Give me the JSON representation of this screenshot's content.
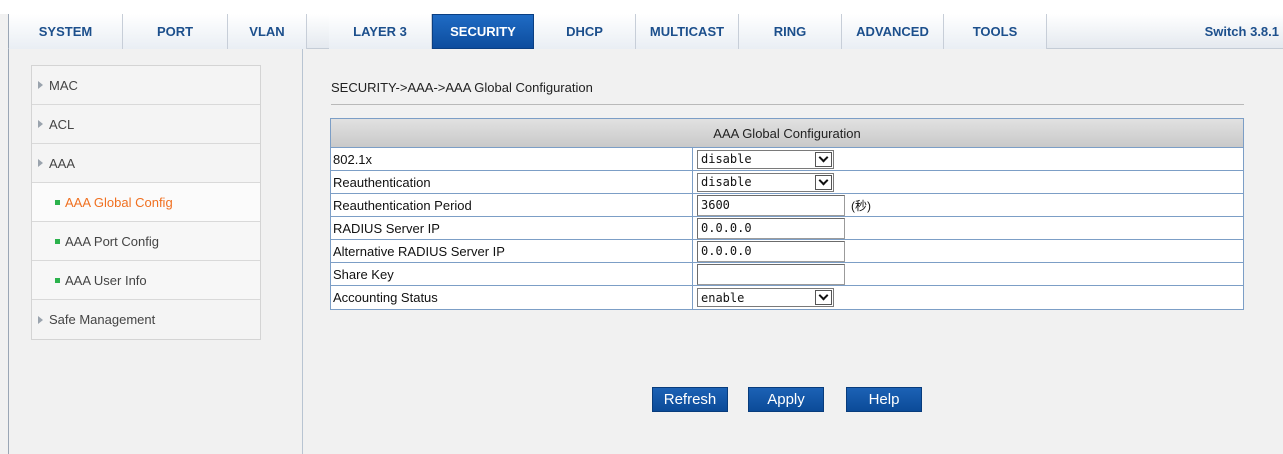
{
  "nav": {
    "tabs": [
      {
        "label": "SYSTEM"
      },
      {
        "label": "PORT"
      },
      {
        "label": "VLAN"
      },
      {
        "label": "LAYER 3"
      },
      {
        "label": "SECURITY"
      },
      {
        "label": "DHCP"
      },
      {
        "label": "MULTICAST"
      },
      {
        "label": "RING"
      },
      {
        "label": "ADVANCED"
      },
      {
        "label": "TOOLS"
      }
    ],
    "active_tab": "SECURITY",
    "version": "Switch 3.8.1"
  },
  "sidebar": {
    "items": [
      {
        "label": "MAC"
      },
      {
        "label": "ACL"
      },
      {
        "label": "AAA"
      },
      {
        "label": "AAA Global Config"
      },
      {
        "label": "AAA Port Config"
      },
      {
        "label": "AAA User Info"
      },
      {
        "label": "Safe Management"
      }
    ],
    "current": "AAA Global Config"
  },
  "main": {
    "breadcrumb": "SECURITY->AAA->AAA Global Configuration",
    "table_title": "AAA Global Configuration",
    "rows": [
      {
        "label": "802.1x",
        "value": "disable"
      },
      {
        "label": "Reauthentication",
        "value": "disable"
      },
      {
        "label": "Reauthentication Period",
        "value": "3600",
        "unit": "(秒)"
      },
      {
        "label": "RADIUS Server IP",
        "value": "0.0.0.0"
      },
      {
        "label": "Alternative RADIUS Server IP",
        "value": "0.0.0.0"
      },
      {
        "label": "Share Key",
        "value": ""
      },
      {
        "label": "Accounting Status",
        "value": "enable"
      }
    ]
  },
  "buttons": {
    "refresh": "Refresh",
    "apply": "Apply",
    "help": "Help"
  },
  "colors": {
    "active_tab": "#1565c0",
    "tab_text": "#1c4f8c",
    "current_item": "#f07020",
    "bullet": "#2bb24c",
    "button": "#0d4d9e"
  }
}
